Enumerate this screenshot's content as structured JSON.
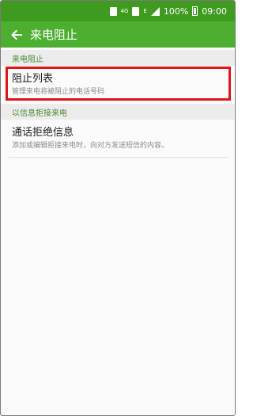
{
  "status_bar": {
    "network_label": "4G",
    "network_sub": "E",
    "battery": "100%",
    "time": "09:00"
  },
  "app_bar": {
    "title": "来电阻止"
  },
  "sections": [
    {
      "header": "来电阻止",
      "items": [
        {
          "title": "阻止列表",
          "subtitle": "管理来电将被阻止的电话号码"
        }
      ]
    },
    {
      "header": "以信息拒接来电",
      "items": [
        {
          "title": "通话拒绝信息",
          "subtitle": "添加或编辑拒接来电时，向对方发送短信的内容。"
        }
      ]
    }
  ],
  "colors": {
    "status_bar": "#3e9b1f",
    "app_bar": "#4caf30",
    "section_text": "#4a8a2e",
    "highlight": "#e0141a"
  }
}
